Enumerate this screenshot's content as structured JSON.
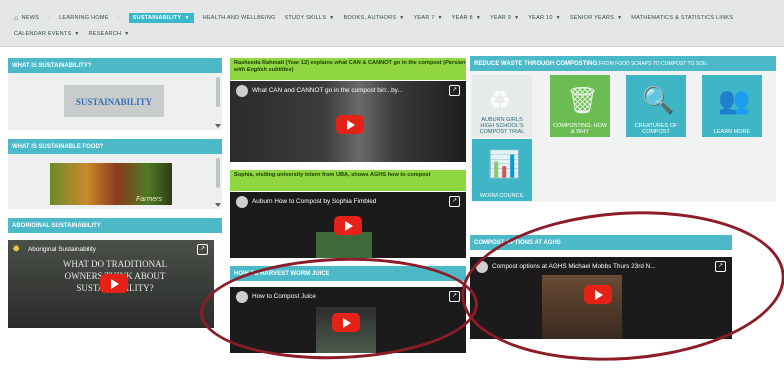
{
  "nav": {
    "row1": [
      {
        "label": "News",
        "icon": "home-icon",
        "sep": "-"
      },
      {
        "label": "Learning Home",
        "sep": "-"
      },
      {
        "label": "Sustainability",
        "caret": "▼",
        "active": true
      },
      {
        "label": "Health and Wellbeing"
      },
      {
        "label": "Study Skills",
        "caret": "▼"
      },
      {
        "label": "Books, Authors",
        "caret": "▼"
      },
      {
        "label": "Year 7",
        "caret": "▼"
      },
      {
        "label": "Year 8",
        "caret": "▼"
      },
      {
        "label": "Year 9",
        "caret": "▼"
      },
      {
        "label": "Year 10",
        "caret": "▼"
      },
      {
        "label": "Senior Years",
        "caret": "▼"
      },
      {
        "label": "Mathematics & Statistics Links"
      }
    ],
    "row2": [
      {
        "label": "Calendar Events",
        "caret": "▼"
      },
      {
        "label": "Research",
        "caret": "▼"
      }
    ]
  },
  "left": {
    "sustainability": {
      "header": "What is sustainability?",
      "image_text": "SUSTAINABILITY"
    },
    "food": {
      "header": "What is sustainable food?",
      "image_text": "Farmers"
    },
    "aboriginal": {
      "header": "Aboriginal sustainability",
      "video_title": "Aboriginal Sustainability",
      "overlay": "WHAT DO TRADITIONAL OWNERS THINK ABOUT SUSTAINABILITY?"
    }
  },
  "middle": {
    "card1": {
      "header_bold": "Rasheeda Rahmati",
      "header_rest": " (Year 12) explains what CAN & CANNOT go in the compost (",
      "header_sub": "Persian with English subtitles",
      "header_end": ")",
      "video_title": "What CAN and CANNOT go in the compost bin:..by..."
    },
    "card2": {
      "header": "Sophia, visiting university intern from UBA, shows AGHS how to compost",
      "video_title": "Auburn How to Compost by Sophia Fimbled"
    },
    "card3": {
      "header": "How to harvest worm juice",
      "video_title": "How to Compost Juice"
    }
  },
  "right": {
    "reduce": {
      "header": "Reduce waste through composting:",
      "header_rest": " from food scraps to compost to soil",
      "tiles": [
        {
          "label": "Auburn Girls High School's Compost Trial",
          "icon": "logo-icon",
          "glyph": "♻"
        },
        {
          "label": "Composting: how & why",
          "icon": "bin-icon",
          "glyph": "🗑"
        },
        {
          "label": "Creatures of compost",
          "icon": "magnifier-icon",
          "glyph": "🔍"
        },
        {
          "label": "Learn more",
          "icon": "video-people-icon",
          "glyph": "👥"
        },
        {
          "label": "Worm council",
          "icon": "presentation-icon",
          "glyph": "📊"
        }
      ]
    },
    "compost": {
      "header": "Compost options at AGHS",
      "video_title": "Compost options at AGHS Michael Mobbs Thurs 23rd N..."
    }
  },
  "share_glyph": "↗",
  "colors": {
    "accent": "#4cb9c9",
    "green_header": "#8fd640",
    "annotation": "#8c1d28",
    "play": "#e62117"
  }
}
